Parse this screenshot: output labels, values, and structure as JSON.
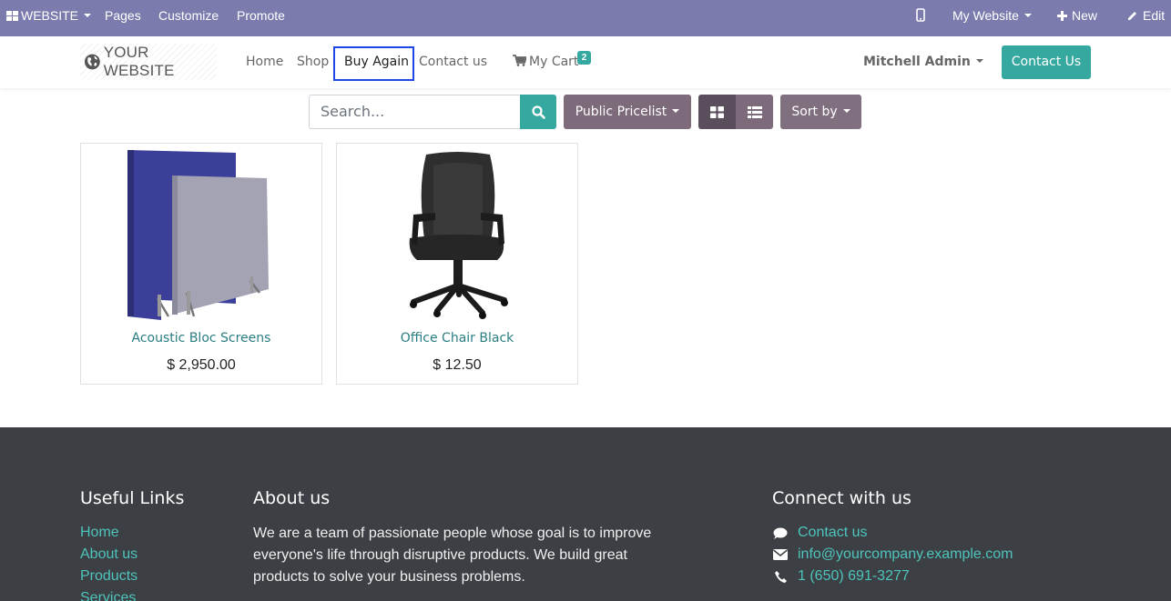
{
  "adminbar": {
    "app_menu": "WEBSITE",
    "pages": "Pages",
    "customize": "Customize",
    "promote": "Promote",
    "site_switch": "My Website",
    "new": "New",
    "edit": "Edit"
  },
  "header": {
    "logo_text": "YOUR WEBSITE",
    "nav": [
      "Home",
      "Shop",
      "Buy Again",
      "Contact us"
    ],
    "cart_label": "My Cart",
    "cart_count": "2",
    "user": "Mitchell Admin",
    "contact_button": "Contact Us"
  },
  "toolbar": {
    "search_placeholder": "Search...",
    "pricelist": "Public Pricelist",
    "sort": "Sort by"
  },
  "products": [
    {
      "name": "Acoustic Bloc Screens",
      "price": "$ 2,950.00"
    },
    {
      "name": "Office Chair Black",
      "price": "$ 12.50"
    }
  ],
  "footer": {
    "links_title": "Useful Links",
    "links": [
      "Home",
      "About us",
      "Products",
      "Services"
    ],
    "about_title": "About us",
    "about_text": "We are a team of passionate people whose goal is to improve everyone's life through disruptive products. We build great products to solve your business problems.",
    "connect_title": "Connect with us",
    "connect_contact": "Contact us",
    "connect_email": "info@yourcompany.example.com",
    "connect_phone": "1 (650) 691-3277"
  },
  "colors": {
    "adminbar": "#7c7bad",
    "accent": "#35a8a0",
    "pill": "#7d6a7b",
    "footer": "#3c3f44",
    "highlight_border": "#1f47e6"
  }
}
